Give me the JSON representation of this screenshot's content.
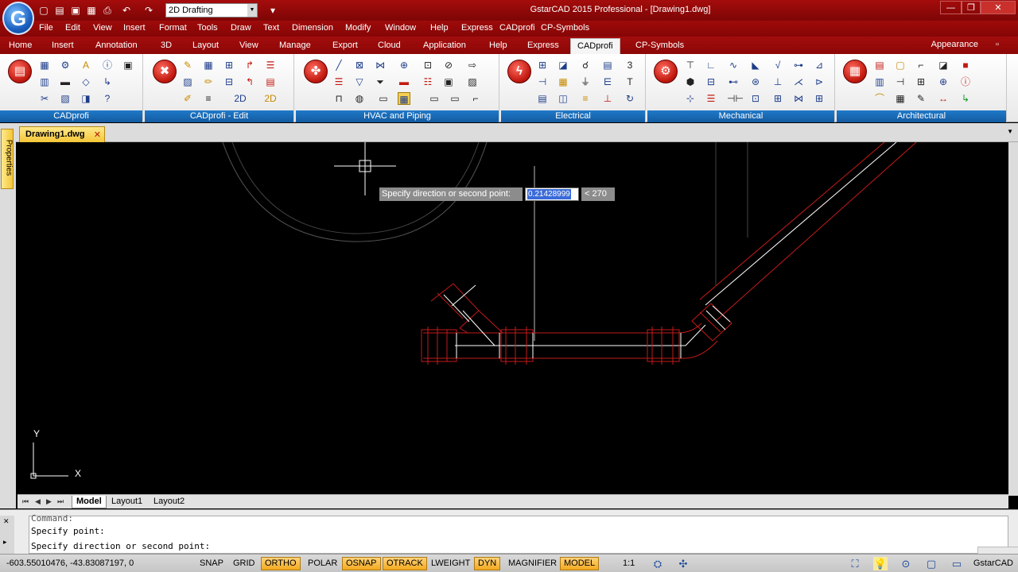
{
  "titlebar": {
    "logo": "G",
    "workspace": "2D Drafting",
    "title": "GstarCAD 2015 Professional - [Drawing1.dwg]",
    "quick_access_icons": [
      "new-icon",
      "open-icon",
      "save-icon",
      "save-as-icon",
      "print-icon",
      "undo-icon",
      "redo-icon"
    ],
    "customize": "▾"
  },
  "window_controls": {
    "minimize": "—",
    "restore": "❐",
    "close": "✕"
  },
  "menubar": [
    "File",
    "Edit",
    "View",
    "Insert",
    "Format",
    "Tools",
    "Draw",
    "Text",
    "Dimension",
    "Modify",
    "Window",
    "Help",
    "Express",
    "CADprofi",
    "CP-Symbols"
  ],
  "ribbon_tabs": [
    "Home",
    "Insert",
    "Annotation",
    "3D",
    "Layout",
    "View",
    "Manage",
    "Export",
    "Cloud",
    "Application",
    "Help",
    "Express",
    "CADprofi",
    "CP-Symbols"
  ],
  "ribbon_active_tab": "CADprofi",
  "appearance_label": "Appearance",
  "ribbon_panels": [
    "CADprofi",
    "CADprofi - Edit",
    "HVAC and Piping",
    "Electrical",
    "Mechanical",
    "Architectural"
  ],
  "document_tab": {
    "name": "Drawing1.dwg",
    "close": "✕"
  },
  "properties_tab": "Properties",
  "canvas": {
    "tooltip_prompt": "Specify direction or second point:",
    "tooltip_value": "0.21428999",
    "tooltip_angle": "< 270",
    "ucs_x": "X",
    "ucs_y": "Y",
    "colors": {
      "pipe_red": "#c21a1a",
      "pipe_white": "#ffffff",
      "faint": "#5a5a5a"
    }
  },
  "layout_tabs": {
    "nav": [
      "⏮",
      "◀",
      "▶",
      "⏭"
    ],
    "tabs": [
      "Model",
      "Layout1",
      "Layout2"
    ],
    "active": "Model"
  },
  "command": {
    "lines": [
      "Command:",
      "Specify point:",
      "Specify direction or second point:"
    ]
  },
  "status": {
    "coords": "-603.55010476, -43.83087197, 0",
    "toggles": [
      {
        "label": "SNAP",
        "on": false
      },
      {
        "label": "GRID",
        "on": false
      },
      {
        "label": "ORTHO",
        "on": true
      },
      {
        "label": "POLAR",
        "on": false
      },
      {
        "label": "OSNAP",
        "on": true
      },
      {
        "label": "OTRACK",
        "on": true
      },
      {
        "label": "LWEIGHT",
        "on": false
      },
      {
        "label": "DYN",
        "on": true
      },
      {
        "label": "MAGNIFIER",
        "on": false
      },
      {
        "label": "MODEL",
        "on": true
      }
    ],
    "scale": "1:1",
    "brand": "GstarCAD"
  }
}
